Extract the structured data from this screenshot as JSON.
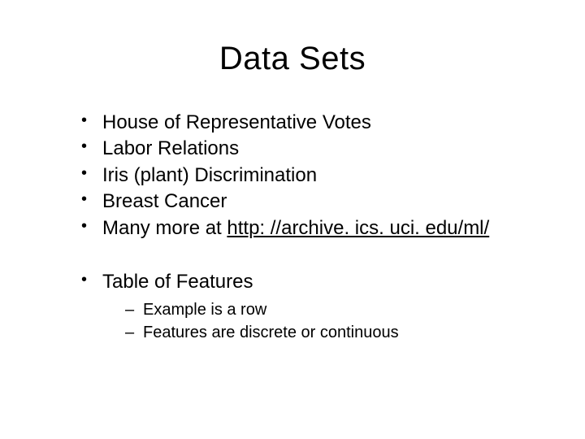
{
  "title": "Data Sets",
  "bullets": {
    "b0": "House of Representative Votes",
    "b1": "Labor Relations",
    "b2": "Iris (plant) Discrimination",
    "b3": "Breast Cancer",
    "b4_prefix": "Many more at ",
    "b4_link": "http: //archive. ics. uci. edu/ml/",
    "b5": "Table of Features"
  },
  "sub": {
    "s0": "Example is a row",
    "s1": "Features are discrete or continuous"
  }
}
